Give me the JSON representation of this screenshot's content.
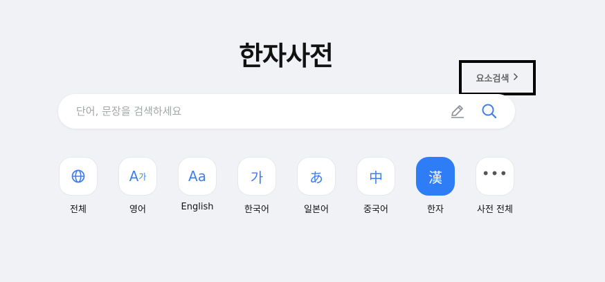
{
  "header": {
    "title": "한자사전",
    "element_search_label": "요소검색"
  },
  "search": {
    "placeholder": "단어, 문장을 검색하세요"
  },
  "categories": [
    {
      "label": "전체",
      "icon": "globe-icon"
    },
    {
      "label": "영어",
      "icon_text_main": "A",
      "icon_text_sub": "가"
    },
    {
      "label": "English",
      "icon_text": "Aa"
    },
    {
      "label": "한국어",
      "icon_text": "가"
    },
    {
      "label": "일본어",
      "icon_text": "あ"
    },
    {
      "label": "중국어",
      "icon_text": "中"
    },
    {
      "label": "한자",
      "icon_text": "漢",
      "active": true
    },
    {
      "label": "사전 전체",
      "icon_text": "•••"
    }
  ],
  "colors": {
    "accent": "#2f7df6",
    "background": "#f1f2f6",
    "icon_blue": "#3d7ef0"
  }
}
